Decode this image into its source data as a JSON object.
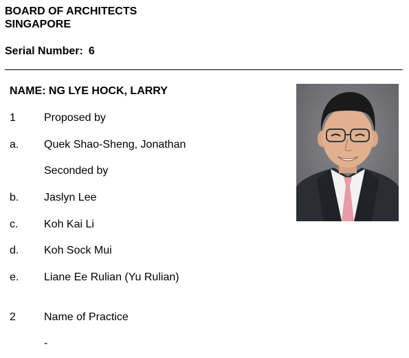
{
  "header": {
    "org_line1": "BOARD OF ARCHITECTS",
    "org_line2": "SINGAPORE",
    "serial_label": "Serial Number:",
    "serial_value": "6"
  },
  "nominee": {
    "name_label": "NAME: NG LYE HOCK, LARRY"
  },
  "section1": {
    "number": "1",
    "title": "Proposed by",
    "proposer_letter": "a.",
    "proposer": "Quek Shao-Sheng, Jonathan",
    "seconded_label": "Seconded by",
    "seconders": [
      {
        "letter": "b.",
        "name": "Jaslyn Lee"
      },
      {
        "letter": "c.",
        "name": "Koh Kai Li"
      },
      {
        "letter": "d.",
        "name": "Koh Sock Mui"
      },
      {
        "letter": "e.",
        "name": "Liane Ee Rulian (Yu Rulian)"
      }
    ]
  },
  "section2": {
    "number": "2",
    "title": "Name of Practice",
    "value": "-"
  },
  "photo": {
    "icon": "portrait-photo",
    "colors": {
      "background": "#6e6e72",
      "suit": "#2a2d33",
      "shirt": "#f2f2f2",
      "tie": "#e89aa6",
      "skin": "#e0b08f",
      "hair": "#1a1a1a"
    }
  }
}
